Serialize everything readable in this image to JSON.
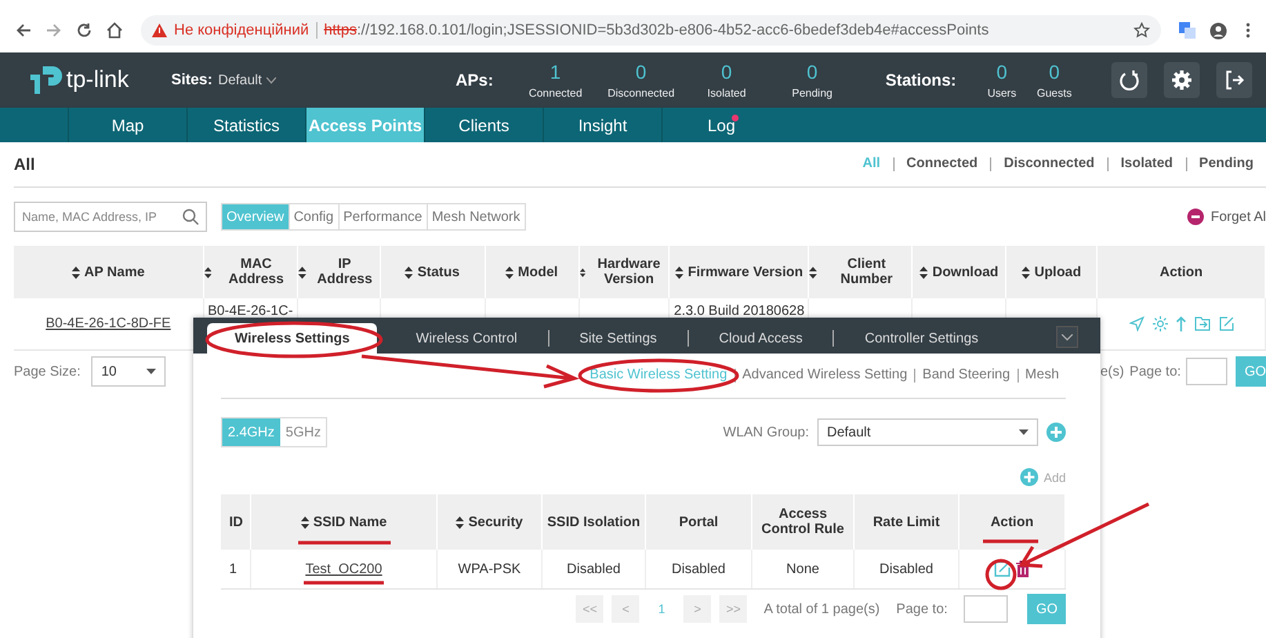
{
  "browser": {
    "security_warning": "Не конфіденційний",
    "url_scheme": "https",
    "url_rest": "://192.168.0.101/login;JSESSIONID=5b3d302b-e806-4b52-acc6-6bedef3deb4e#accessPoints"
  },
  "header": {
    "logo": "tp-link",
    "sites_label": "Sites:",
    "site": "Default",
    "aps_label": "APs:",
    "ap_stats": [
      {
        "value": "1",
        "label": "Connected"
      },
      {
        "value": "0",
        "label": "Disconnected"
      },
      {
        "value": "0",
        "label": "Isolated"
      },
      {
        "value": "0",
        "label": "Pending"
      }
    ],
    "stations_label": "Stations:",
    "station_stats": [
      {
        "value": "0",
        "label": "Users"
      },
      {
        "value": "0",
        "label": "Guests"
      }
    ]
  },
  "nav": [
    {
      "label": "Map",
      "selected": false,
      "alert": false
    },
    {
      "label": "Statistics",
      "selected": false,
      "alert": false
    },
    {
      "label": "Access Points",
      "selected": true,
      "alert": false
    },
    {
      "label": "Clients",
      "selected": false,
      "alert": false
    },
    {
      "label": "Insight",
      "selected": false,
      "alert": false
    },
    {
      "label": "Log",
      "selected": false,
      "alert": true
    }
  ],
  "section_title": "All",
  "filters": [
    {
      "label": "All",
      "selected": true
    },
    {
      "label": "Connected",
      "selected": false
    },
    {
      "label": "Disconnected",
      "selected": false
    },
    {
      "label": "Isolated",
      "selected": false
    },
    {
      "label": "Pending",
      "selected": false
    }
  ],
  "search": {
    "placeholder": "Name, MAC Address, IP"
  },
  "view_tabs": [
    {
      "label": "Overview",
      "selected": true
    },
    {
      "label": "Config",
      "selected": false
    },
    {
      "label": "Performance",
      "selected": false
    },
    {
      "label": "Mesh Network",
      "selected": false
    }
  ],
  "forget_all": "Forget Al",
  "ap_table": {
    "columns": [
      {
        "label": "AP Name",
        "sortable": true
      },
      {
        "label": "MAC Address",
        "sortable": true
      },
      {
        "label": "IP Address",
        "sortable": true
      },
      {
        "label": "Status",
        "sortable": true
      },
      {
        "label": "Model",
        "sortable": true
      },
      {
        "label": "Hardware Version",
        "sortable": true
      },
      {
        "label": "Firmware Version",
        "sortable": true
      },
      {
        "label": "Client Number",
        "sortable": true
      },
      {
        "label": "Download",
        "sortable": true
      },
      {
        "label": "Upload",
        "sortable": true
      },
      {
        "label": "Action",
        "sortable": false
      }
    ],
    "rows": [
      {
        "ap_name": "B0-4E-26-1C-8D-FE",
        "mac_address": "B0-4E-26-1C-",
        "firmware_version": "2.3.0 Build 20180628"
      }
    ]
  },
  "page_size": {
    "label": "Page Size:",
    "value": "10"
  },
  "ap_pagination": {
    "total_tail": "e(s)",
    "page_to": "Page to:",
    "go": "GO"
  },
  "settings_panel": {
    "tabs": [
      {
        "label": "Wireless Settings",
        "selected": true
      },
      {
        "label": "Wireless Control",
        "selected": false
      },
      {
        "label": "Site Settings",
        "selected": false
      },
      {
        "label": "Cloud Access",
        "selected": false
      },
      {
        "label": "Controller Settings",
        "selected": false
      }
    ],
    "subtabs": [
      {
        "label": "Basic Wireless Setting",
        "selected": true
      },
      {
        "label": "Advanced Wireless Setting",
        "selected": false
      },
      {
        "label": "Band Steering",
        "selected": false
      },
      {
        "label": "Mesh",
        "selected": false
      }
    ],
    "bands": [
      {
        "label": "2.4GHz",
        "selected": true
      },
      {
        "label": "5GHz",
        "selected": false
      }
    ],
    "wlan_group": {
      "label": "WLAN Group:",
      "value": "Default"
    },
    "add": "Add",
    "columns": [
      {
        "label": "ID",
        "sortable": false
      },
      {
        "label": "SSID Name",
        "sortable": true
      },
      {
        "label": "Security",
        "sortable": true
      },
      {
        "label": "SSID Isolation",
        "sortable": false
      },
      {
        "label": "Portal",
        "sortable": false
      },
      {
        "label": "Access Control Rule",
        "sortable": false
      },
      {
        "label": "Rate Limit",
        "sortable": false
      },
      {
        "label": "Action",
        "sortable": false
      }
    ],
    "rows": [
      {
        "id": "1",
        "ssid": "Test_OC200",
        "security": "WPA-PSK",
        "isolation": "Disabled",
        "portal": "Disabled",
        "access_control": "None",
        "rate_limit": "Disabled"
      }
    ],
    "pagination": {
      "first": "<<",
      "prev": "<",
      "page": "1",
      "next": ">",
      "last": ">>",
      "total": "A total of 1 page(s)",
      "page_to": "Page to:",
      "go": "GO"
    }
  }
}
